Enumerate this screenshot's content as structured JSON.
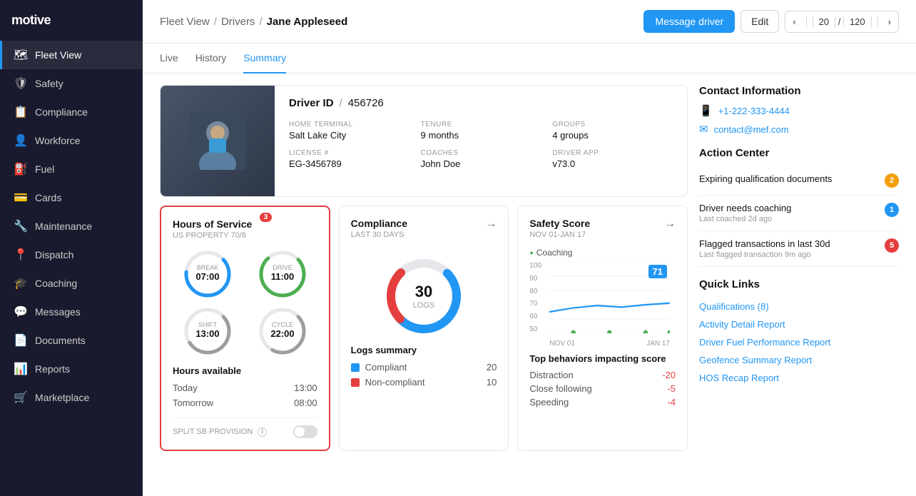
{
  "sidebar": {
    "logo": "motive",
    "items": [
      {
        "id": "fleet-view",
        "label": "Fleet View",
        "icon": "🗺",
        "active": true
      },
      {
        "id": "safety",
        "label": "Safety",
        "icon": "🛡",
        "active": false
      },
      {
        "id": "compliance",
        "label": "Compliance",
        "icon": "📋",
        "active": false
      },
      {
        "id": "workforce",
        "label": "Workforce",
        "icon": "👤",
        "active": false
      },
      {
        "id": "fuel",
        "label": "Fuel",
        "icon": "⛽",
        "active": false
      },
      {
        "id": "cards",
        "label": "Cards",
        "icon": "💳",
        "active": false
      },
      {
        "id": "maintenance",
        "label": "Maintenance",
        "icon": "🔧",
        "active": false
      },
      {
        "id": "dispatch",
        "label": "Dispatch",
        "icon": "📍",
        "active": false
      },
      {
        "id": "coaching",
        "label": "Coaching",
        "icon": "🎓",
        "active": false
      },
      {
        "id": "messages",
        "label": "Messages",
        "icon": "💬",
        "active": false
      },
      {
        "id": "documents",
        "label": "Documents",
        "icon": "📄",
        "active": false
      },
      {
        "id": "reports",
        "label": "Reports",
        "icon": "📊",
        "active": false
      },
      {
        "id": "marketplace",
        "label": "Marketplace",
        "icon": "🛒",
        "active": false
      }
    ]
  },
  "header": {
    "breadcrumb": [
      "Fleet View",
      "Drivers",
      "Jane Appleseed"
    ],
    "message_driver_label": "Message driver",
    "edit_label": "Edit",
    "nav_current": "20",
    "nav_total": "120"
  },
  "tabs": [
    {
      "id": "live",
      "label": "Live"
    },
    {
      "id": "history",
      "label": "History"
    },
    {
      "id": "summary",
      "label": "Summary",
      "active": true
    }
  ],
  "driver": {
    "id_label": "Driver ID",
    "id_sep": "/",
    "id_value": "456726",
    "home_terminal_label": "HOME TERMINAL",
    "home_terminal_value": "Salt Lake City",
    "tenure_label": "TENURE",
    "tenure_value": "9 months",
    "groups_label": "GROUPS",
    "groups_value": "4 groups",
    "license_label": "LICENSE #",
    "license_value": "EG-3456789",
    "coaches_label": "COACHES",
    "coaches_value": "John Doe",
    "driver_app_label": "DRIVER APP",
    "driver_app_value": "v73.0"
  },
  "hos_widget": {
    "title": "Hours of Service",
    "subtitle": "US PROPERTY 70/8",
    "break_label": "BREAK",
    "break_value": "07:00",
    "drive_label": "DRIVE",
    "drive_value": "11:00",
    "shift_label": "SHIFT",
    "shift_value": "13:00",
    "cycle_label": "CYCLE",
    "cycle_value": "22:00",
    "hours_available_title": "Hours available",
    "today_label": "Today",
    "today_value": "13:00",
    "tomorrow_label": "Tomorrow",
    "tomorrow_value": "08:00",
    "split_sb_label": "SPLIT SB PROVISION",
    "badge_count": "3"
  },
  "compliance_widget": {
    "title": "Compliance",
    "subtitle": "LAST 30 DAYS",
    "donut_number": "30",
    "donut_sub": "LOGS",
    "compliant_value": 20,
    "noncompliant_value": 10,
    "logs_summary_title": "Logs summary",
    "compliant_label": "Compliant",
    "noncompliant_label": "Non-compliant"
  },
  "safety_widget": {
    "title": "Safety Score",
    "subtitle": "NOV 01-JAN 17",
    "score": "71",
    "coaching_label": "Coaching",
    "y_labels": [
      "100",
      "90",
      "80",
      "70",
      "60",
      "50"
    ],
    "x_labels": [
      "NOV 01",
      "JAN 17"
    ],
    "behaviors_title": "Top behaviors impacting score",
    "behaviors": [
      {
        "label": "Distraction",
        "value": "-20"
      },
      {
        "label": "Close following",
        "value": "-5"
      },
      {
        "label": "Speeding",
        "value": "-4"
      }
    ]
  },
  "contact": {
    "title": "Contact Information",
    "phone": "+1-222-333-4444",
    "email": "contact@mef.com"
  },
  "action_center": {
    "title": "Action Center",
    "items": [
      {
        "label": "Expiring qualification documents",
        "sub": "",
        "badge": "2",
        "badge_color": "orange"
      },
      {
        "label": "Driver needs coaching",
        "sub": "Last coached 2d ago",
        "badge": "1",
        "badge_color": "blue"
      },
      {
        "label": "Flagged transactions in last 30d",
        "sub": "Last flagged transaction 9m ago",
        "badge": "5",
        "badge_color": "red"
      }
    ]
  },
  "quick_links": {
    "title": "Quick Links",
    "items": [
      "Qualifications (8)",
      "Activity Detail Report",
      "Driver Fuel Performance Report",
      "Geofence Summary Report",
      "HOS Recap Report"
    ]
  }
}
